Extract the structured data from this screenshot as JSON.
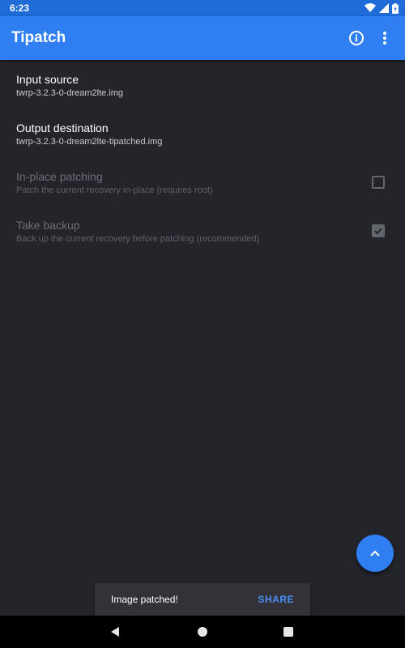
{
  "status_bar": {
    "time": "6:23",
    "icons": [
      "wifi-icon",
      "signal-icon",
      "battery-icon"
    ]
  },
  "app_bar": {
    "title": "Tipatch",
    "actions": [
      "info-icon",
      "overflow-menu-icon"
    ]
  },
  "settings": [
    {
      "title": "Input source",
      "summary": "twrp-3.2.3-0-dream2lte.img",
      "enabled": true
    },
    {
      "title": "Output destination",
      "summary": "twrp-3.2.3-0-dream2lte-tipatched.img",
      "enabled": true
    },
    {
      "title": "In-place patching",
      "summary": "Patch the current recovery in-place (requires root)",
      "enabled": false,
      "checked": false
    },
    {
      "title": "Take backup",
      "summary": "Back up the current recovery before patching (recommended)",
      "enabled": false,
      "checked": true
    }
  ],
  "fab": {
    "icon": "chevron-up-icon"
  },
  "snackbar": {
    "message": "Image patched!",
    "action": "SHARE"
  },
  "nav_bar": {
    "buttons": [
      "back-icon",
      "home-icon",
      "recents-icon"
    ]
  },
  "colors": {
    "accent": "#2f7ff2",
    "status_bar": "#1f6bd8",
    "background": "#24252b",
    "snackbar_action": "#4a8ff5"
  }
}
